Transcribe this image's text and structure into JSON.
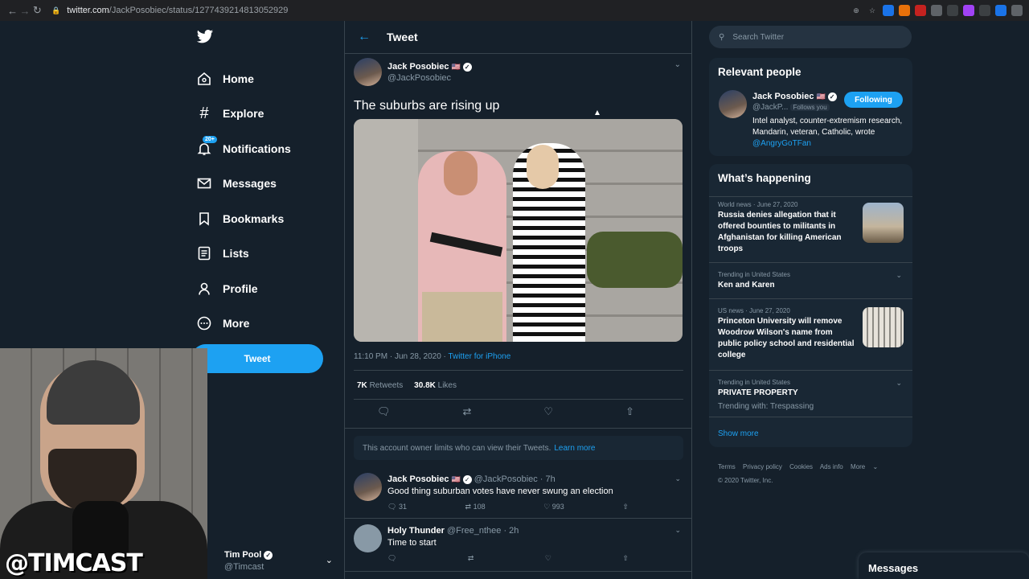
{
  "browser": {
    "url_domain": "twitter.com",
    "url_path": "/JackPosobiec/status/1277439214813052929"
  },
  "nav": {
    "items": [
      {
        "label": "Home",
        "icon": "home-icon"
      },
      {
        "label": "Explore",
        "icon": "hash-icon"
      },
      {
        "label": "Notifications",
        "icon": "bell-icon",
        "badge": "20+"
      },
      {
        "label": "Messages",
        "icon": "mail-icon"
      },
      {
        "label": "Bookmarks",
        "icon": "bookmark-icon"
      },
      {
        "label": "Lists",
        "icon": "list-icon"
      },
      {
        "label": "Profile",
        "icon": "person-icon"
      },
      {
        "label": "More",
        "icon": "more-icon"
      }
    ],
    "tweet_button": "Tweet"
  },
  "account": {
    "name": "Tim Pool",
    "handle": "@Timcast"
  },
  "webcam": {
    "overlay": "@TIMCAST"
  },
  "header": {
    "title": "Tweet"
  },
  "tweet": {
    "author": "Jack Posobiec",
    "handle": "@JackPosobiec",
    "text": "The suburbs are rising up",
    "time": "11:10 PM · Jun 28, 2020 · ",
    "source": "Twitter for iPhone",
    "retweets": "7K",
    "retweets_label": "Retweets",
    "likes": "30.8K",
    "likes_label": "Likes"
  },
  "notice": {
    "text": "This account owner limits who can view their Tweets.",
    "link": "Learn more"
  },
  "replies": [
    {
      "name": "Jack Posobiec",
      "handle": "@JackPosobiec · 7h",
      "text": "Good thing suburban votes have never swung an election",
      "reply_count": "31",
      "retweet_count": "108",
      "like_count": "993"
    },
    {
      "name": "Holy Thunder",
      "handle": "@Free_nthee · 2h",
      "text": "Time to start",
      "reply_count": "",
      "retweet_count": "",
      "like_count": ""
    }
  ],
  "search": {
    "placeholder": "Search Twitter"
  },
  "relevant": {
    "title": "Relevant people",
    "name": "Jack Posobiec",
    "handle": "@JackP...",
    "follows_you": "Follows you",
    "follow_button": "Following",
    "bio": "Intel analyst, counter-extremism research, Mandarin, veteran, Catholic, wrote ",
    "bio_link": "@AngryGoTFan"
  },
  "happening": {
    "title": "What’s happening",
    "items": [
      {
        "category": "World news · June 27, 2020",
        "headline": "Russia denies allegation that it offered bounties to militants in Afghanistan for killing American troops",
        "sub": ""
      },
      {
        "category": "Trending in United States",
        "headline": "Ken and Karen",
        "sub": ""
      },
      {
        "category": "US news · June 27, 2020",
        "headline": "Princeton University will remove Woodrow Wilson's name from public policy school and residential college",
        "sub": ""
      },
      {
        "category": "Trending in United States",
        "headline": "PRIVATE PROPERTY",
        "sub": "Trending with: Trespassing"
      }
    ],
    "show_more": "Show more"
  },
  "footer": {
    "links": [
      "Terms",
      "Privacy policy",
      "Cookies",
      "Ads info",
      "More"
    ],
    "copyright": "© 2020 Twitter, Inc."
  },
  "messages_bar": {
    "title": "Messages"
  },
  "colors": {
    "background": "#15202b",
    "accent": "#1da1f2",
    "panel": "#192734",
    "muted": "#8899a6"
  }
}
